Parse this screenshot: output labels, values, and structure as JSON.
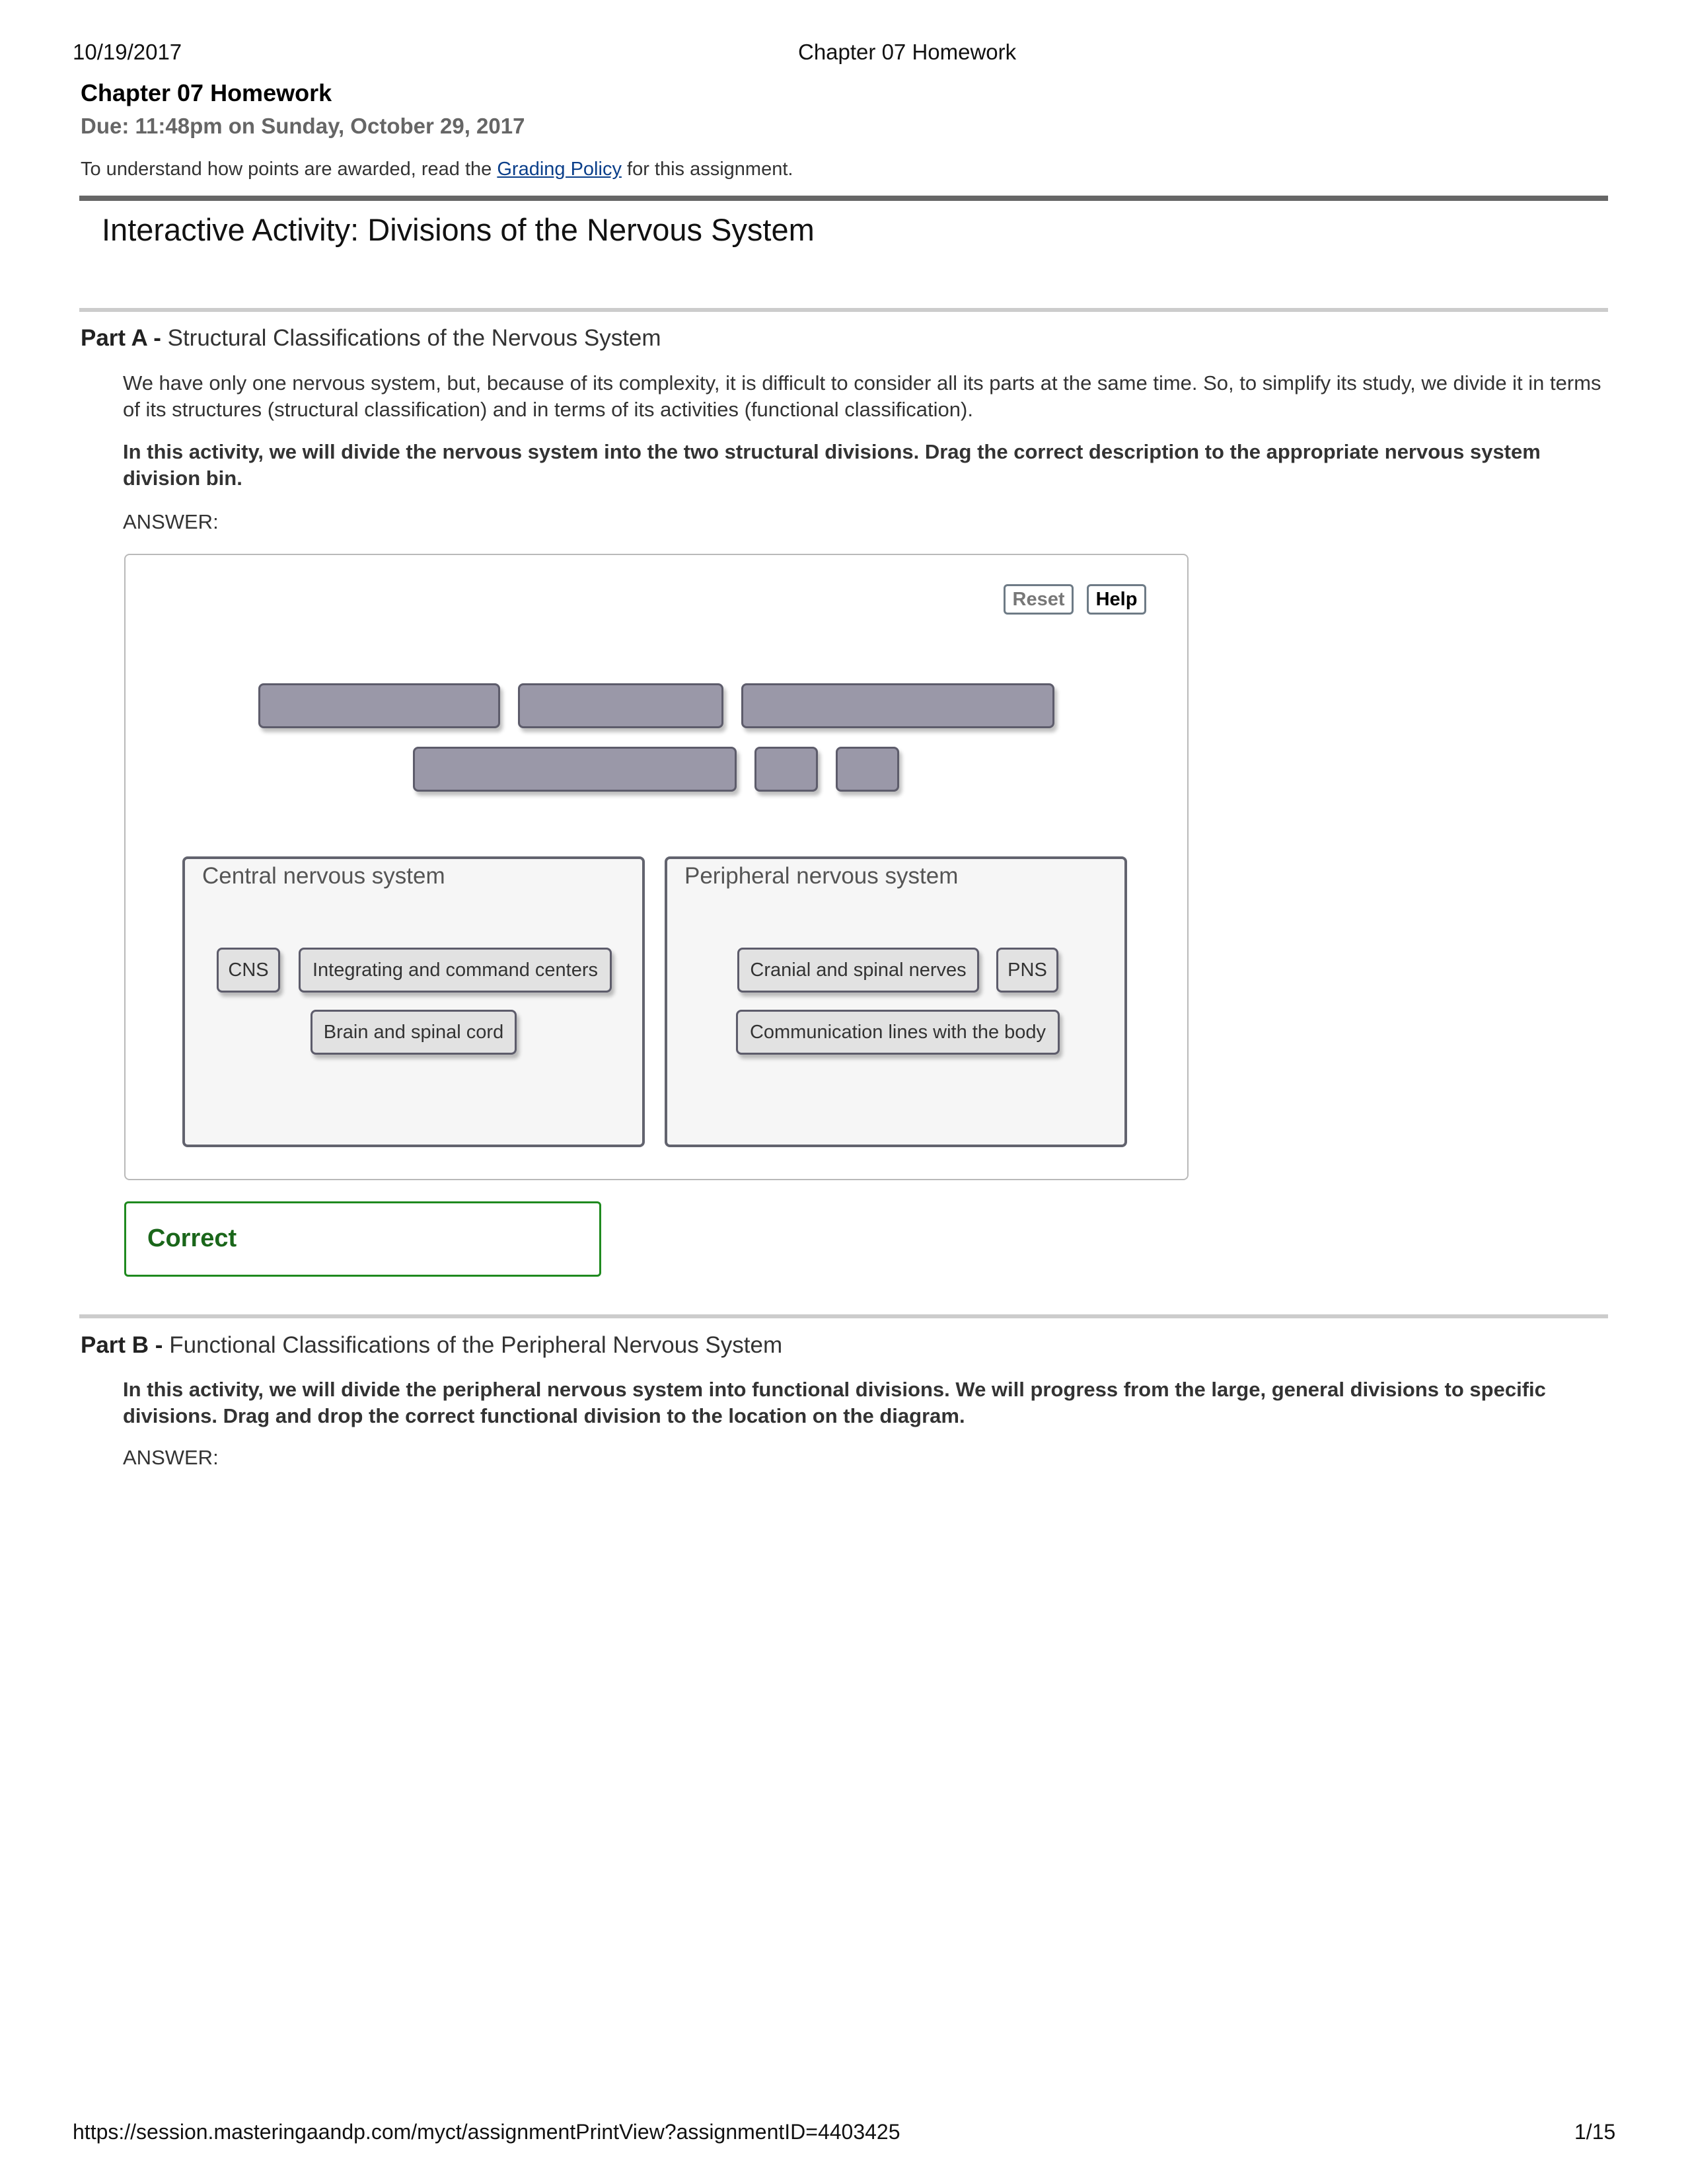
{
  "print_header": {
    "date": "10/19/2017",
    "title": "Chapter 07 Homework"
  },
  "assignment": {
    "title": "Chapter 07 Homework",
    "due": "Due: 11:48pm on Sunday, October 29, 2017",
    "grading_prefix": "To understand how points are awarded, read the ",
    "grading_link": "Grading Policy",
    "grading_suffix": " for this assignment."
  },
  "activity_title": "Interactive Activity: Divisions of the Nervous System",
  "part_a": {
    "label": "Part A - ",
    "title": "Structural Classifications of the Nervous System",
    "intro": "We have only one nervous system, but, because of its complexity, it is difficult to consider all its parts at the same time. So, to simplify its study, we divide it in terms of its structures (structural classification) and in terms of its activities (functional classification).",
    "instruction": "In this activity, we will divide the nervous system into the two structural divisions. Drag the correct description to the appropriate nervous system division bin.",
    "answer_label": "ANSWER:",
    "buttons": {
      "reset": "Reset",
      "help": "Help"
    },
    "empty_slots": 6,
    "bins": [
      {
        "title": "Central nervous system",
        "tiles": [
          "CNS",
          "Integrating and command centers",
          "Brain and spinal cord"
        ]
      },
      {
        "title": "Peripheral nervous system",
        "tiles": [
          "Cranial and spinal nerves",
          "PNS",
          "Communication lines with the body"
        ]
      }
    ],
    "result": "Correct",
    "colors": {
      "result_border": "#1f8a1f",
      "result_text": "#1a661a",
      "slot_fill": "#9a98a8",
      "tile_fill": "#e2e2e2"
    }
  },
  "part_b": {
    "label": "Part B - ",
    "title": "Functional Classifications of the Peripheral Nervous System",
    "instruction": "In this activity, we will divide the peripheral nervous system into functional divisions. We will progress from the large, general divisions to specific divisions. Drag and drop the correct functional division to the location on the diagram.",
    "answer_label": "ANSWER:"
  },
  "print_footer": {
    "url": "https://session.masteringaandp.com/myct/assignmentPrintView?assignmentID=4403425",
    "page": "1/15"
  }
}
